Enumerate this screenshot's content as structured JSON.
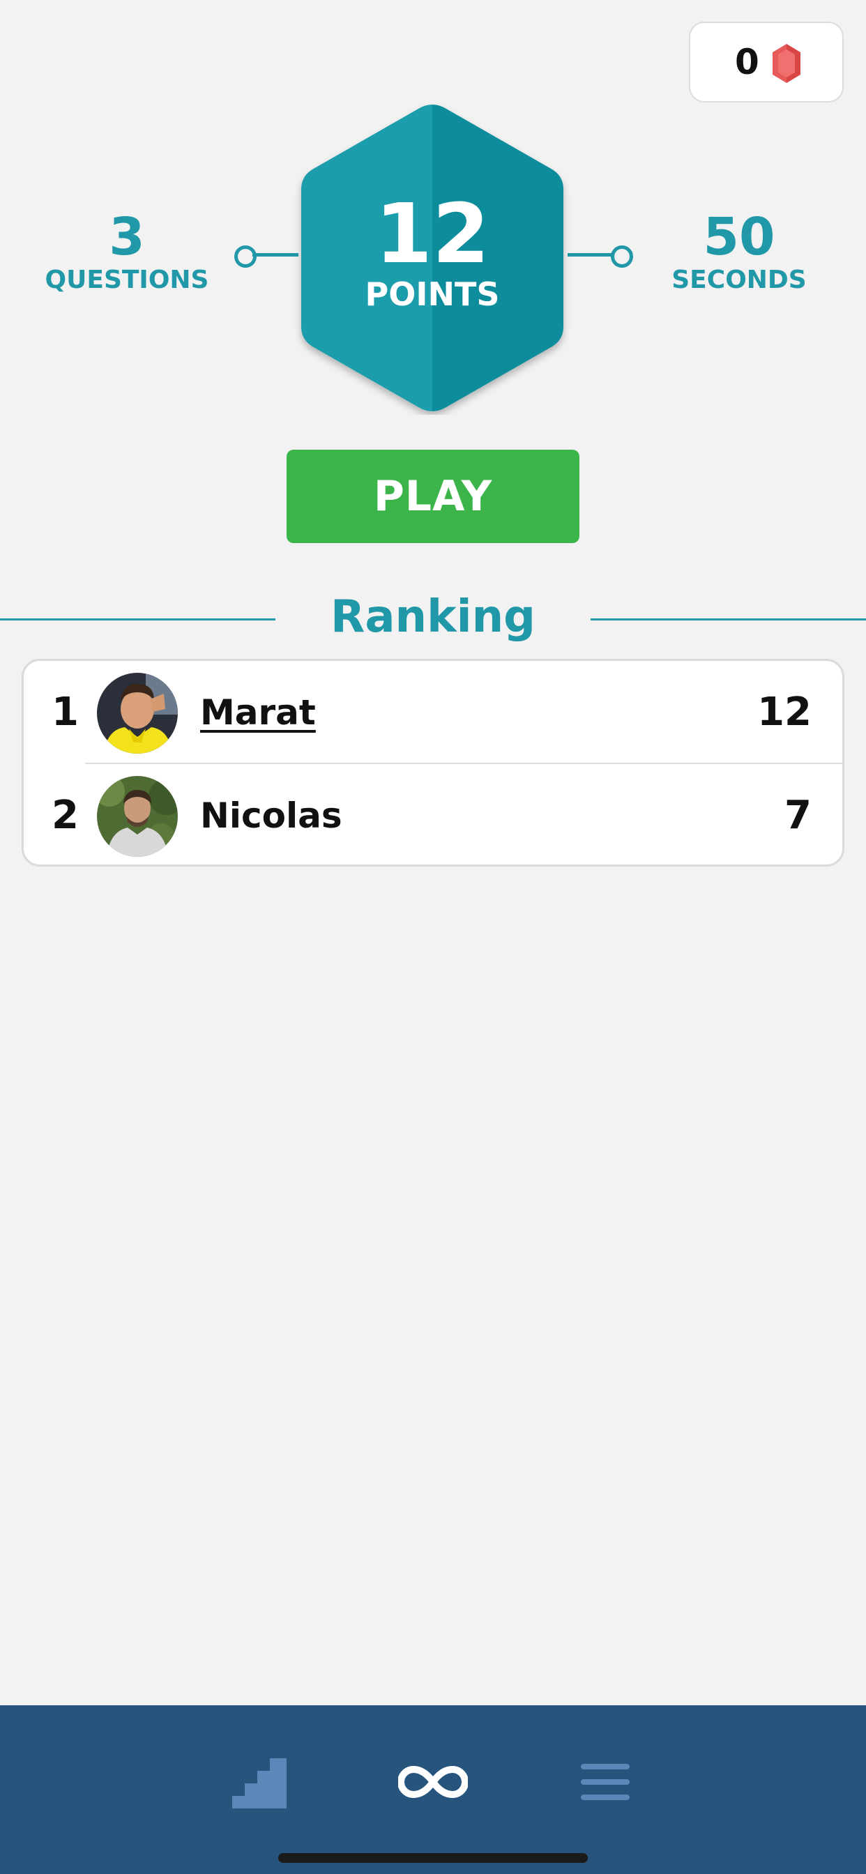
{
  "gems": {
    "count": "0",
    "icon": "gem-icon",
    "color": "#e85a5a"
  },
  "stats": {
    "questions": {
      "value": "3",
      "label": "QUESTIONS"
    },
    "points": {
      "value": "12",
      "label": "POINTS"
    },
    "seconds": {
      "value": "50",
      "label": "SECONDS"
    }
  },
  "play_button": {
    "label": "PLAY"
  },
  "ranking": {
    "title": "Ranking",
    "rows": [
      {
        "position": "1",
        "name": "Marat",
        "score": "12",
        "avatar": "avatar-photo"
      },
      {
        "position": "2",
        "name": "Nicolas",
        "score": "7",
        "avatar": "avatar-photo"
      }
    ]
  },
  "tab_bar": {
    "tabs": [
      {
        "icon": "stairs-icon",
        "name": "ranking"
      },
      {
        "icon": "infinity-icon",
        "name": "play",
        "active": true
      },
      {
        "icon": "menu-icon",
        "name": "menu"
      }
    ]
  },
  "colors": {
    "accent": "#2198a8",
    "play": "#3bb54a",
    "tab_bar": "#27547c",
    "background": "#f2f2f2"
  }
}
